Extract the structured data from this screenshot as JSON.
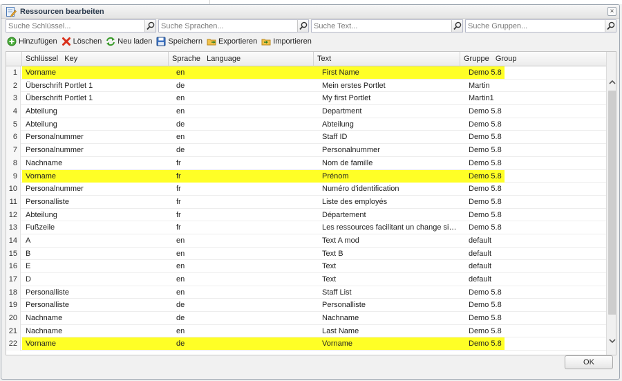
{
  "window": {
    "title": "Ressourcen bearbeiten",
    "close_label": "×"
  },
  "search": {
    "key_placeholder": "Suche Schlüssel...",
    "language_placeholder": "Suche Sprachen...",
    "text_placeholder": "Suche Text...",
    "group_placeholder": "Suche Gruppen..."
  },
  "toolbar": {
    "add_label": "Hinzufügen",
    "delete_label": "Löschen",
    "reload_label": "Neu laden",
    "save_label": "Speichern",
    "export_label": "Exportieren",
    "import_label": "Importieren"
  },
  "table": {
    "columns": {
      "key": "Schlüssel   Key",
      "language": "Sprache   Language",
      "text": "Text",
      "group": "Gruppe   Group"
    },
    "highlight_color": "#ffff26",
    "rows": [
      {
        "n": "1",
        "key": "Vorname",
        "lang": "en",
        "text": "First Name",
        "group": "Demo 5.8",
        "highlighted": true
      },
      {
        "n": "2",
        "key": "Überschrift Portlet 1",
        "lang": "de",
        "text": "Mein erstes Portlet",
        "group": "Martin",
        "highlighted": false
      },
      {
        "n": "3",
        "key": "Überschrift Portlet 1",
        "lang": "en",
        "text": "My first Portlet",
        "group": "Martin1",
        "highlighted": false
      },
      {
        "n": "4",
        "key": "Abteilung",
        "lang": "en",
        "text": "Department",
        "group": "Demo 5.8",
        "highlighted": false
      },
      {
        "n": "5",
        "key": "Abteilung",
        "lang": "de",
        "text": "Abteilung",
        "group": "Demo 5.8",
        "highlighted": false
      },
      {
        "n": "6",
        "key": "Personalnummer",
        "lang": "en",
        "text": "Staff ID",
        "group": "Demo 5.8",
        "highlighted": false
      },
      {
        "n": "7",
        "key": "Personalnummer",
        "lang": "de",
        "text": "Personalnummer",
        "group": "Demo 5.8",
        "highlighted": false
      },
      {
        "n": "8",
        "key": "Nachname",
        "lang": "fr",
        "text": "Nom de famille",
        "group": "Demo 5.8",
        "highlighted": false
      },
      {
        "n": "9",
        "key": "Vorname",
        "lang": "fr",
        "text": "Prénom",
        "group": "Demo 5.8",
        "highlighted": true
      },
      {
        "n": "10",
        "key": "Personalnummer",
        "lang": "fr",
        "text": "Numéro d'identification",
        "group": "Demo 5.8",
        "highlighted": false
      },
      {
        "n": "11",
        "key": "Personalliste",
        "lang": "fr",
        "text": "Liste des employés",
        "group": "Demo 5.8",
        "highlighted": false
      },
      {
        "n": "12",
        "key": "Abteilung",
        "lang": "fr",
        "text": "Département",
        "group": "Demo 5.8",
        "highlighted": false
      },
      {
        "n": "13",
        "key": "Fußzeile",
        "lang": "fr",
        "text": "Les ressources facilitant un change simple...",
        "group": "Demo 5.8",
        "highlighted": false
      },
      {
        "n": "14",
        "key": "A",
        "lang": "en",
        "text": "Text A mod",
        "group": "default",
        "highlighted": false
      },
      {
        "n": "15",
        "key": "B",
        "lang": "en",
        "text": "Text B",
        "group": "default",
        "highlighted": false
      },
      {
        "n": "16",
        "key": "E",
        "lang": "en",
        "text": "Text",
        "group": "default",
        "highlighted": false
      },
      {
        "n": "17",
        "key": "D",
        "lang": "en",
        "text": "Text",
        "group": "default",
        "highlighted": false
      },
      {
        "n": "18",
        "key": "Personalliste",
        "lang": "en",
        "text": "Staff List",
        "group": "Demo 5.8",
        "highlighted": false
      },
      {
        "n": "19",
        "key": "Personalliste",
        "lang": "de",
        "text": "Personalliste",
        "group": "Demo 5.8",
        "highlighted": false
      },
      {
        "n": "20",
        "key": "Nachname",
        "lang": "de",
        "text": "Nachname",
        "group": "Demo 5.8",
        "highlighted": false
      },
      {
        "n": "21",
        "key": "Nachname",
        "lang": "en",
        "text": "Last Name",
        "group": "Demo 5.8",
        "highlighted": false
      },
      {
        "n": "22",
        "key": "Vorname",
        "lang": "de",
        "text": "Vorname",
        "group": "Demo 5.8",
        "highlighted": true
      }
    ]
  },
  "footer": {
    "ok_label": "OK"
  }
}
